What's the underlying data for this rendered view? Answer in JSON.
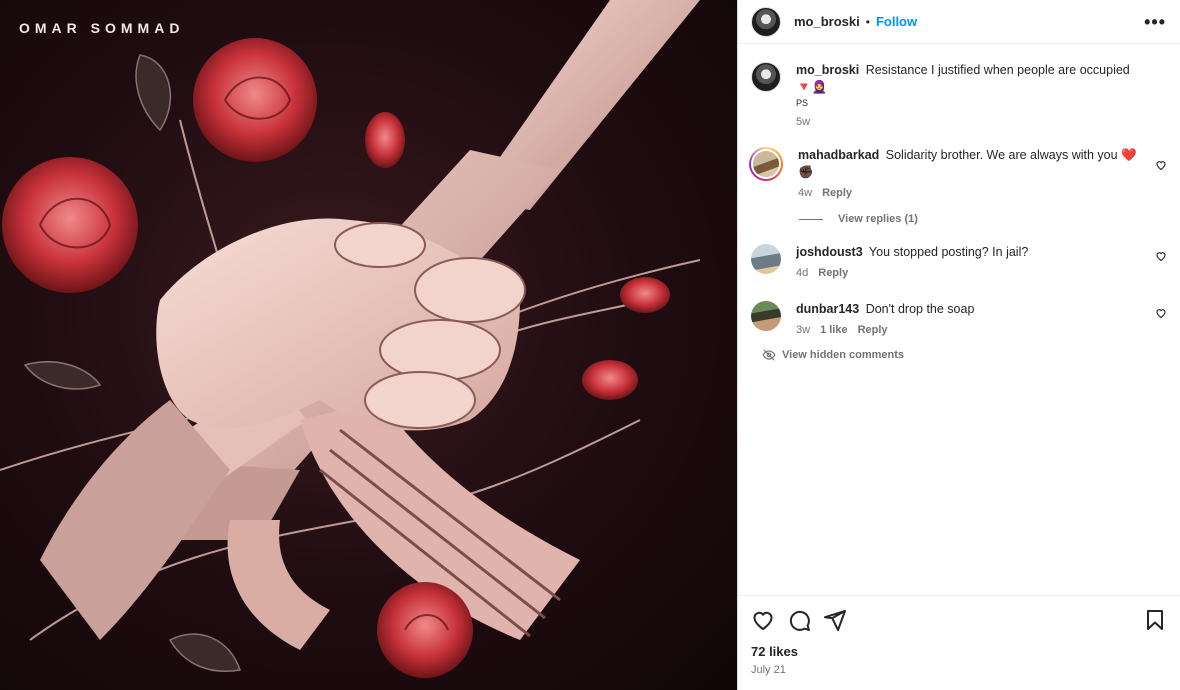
{
  "media": {
    "album_title": "OMAR SOMMAD"
  },
  "header": {
    "username": "mo_broski",
    "separator": "•",
    "follow_label": "Follow",
    "more_label": "•••"
  },
  "caption": {
    "username": "mo_broski",
    "text": "Resistance I justified when people are occupied",
    "emojis": "🔻🧕",
    "ps": "PS",
    "time": "5w"
  },
  "comments": [
    {
      "username": "mahadbarkad",
      "text": "Solidarity brother. We are always with you",
      "emoji": "❤️",
      "emoji2": "✊🏿",
      "time": "4w",
      "reply_label": "Reply"
    },
    {
      "username": "joshdoust3",
      "text": "You stopped posting? In jail?",
      "time": "4d",
      "reply_label": "Reply"
    },
    {
      "username": "dunbar143",
      "text": "Don't drop the soap",
      "time": "3w",
      "likes": "1 like",
      "reply_label": "Reply"
    }
  ],
  "view_replies": "View replies (1)",
  "view_hidden": "View hidden comments",
  "footer": {
    "likes": "72 likes",
    "date": "July 21"
  },
  "icons": [
    "heart-icon",
    "comment-icon",
    "share-icon",
    "bookmark-icon",
    "more-icon",
    "eye-off-icon"
  ],
  "colors": {
    "follow": "#0095f6",
    "muted": "#737373",
    "text": "#262626"
  }
}
